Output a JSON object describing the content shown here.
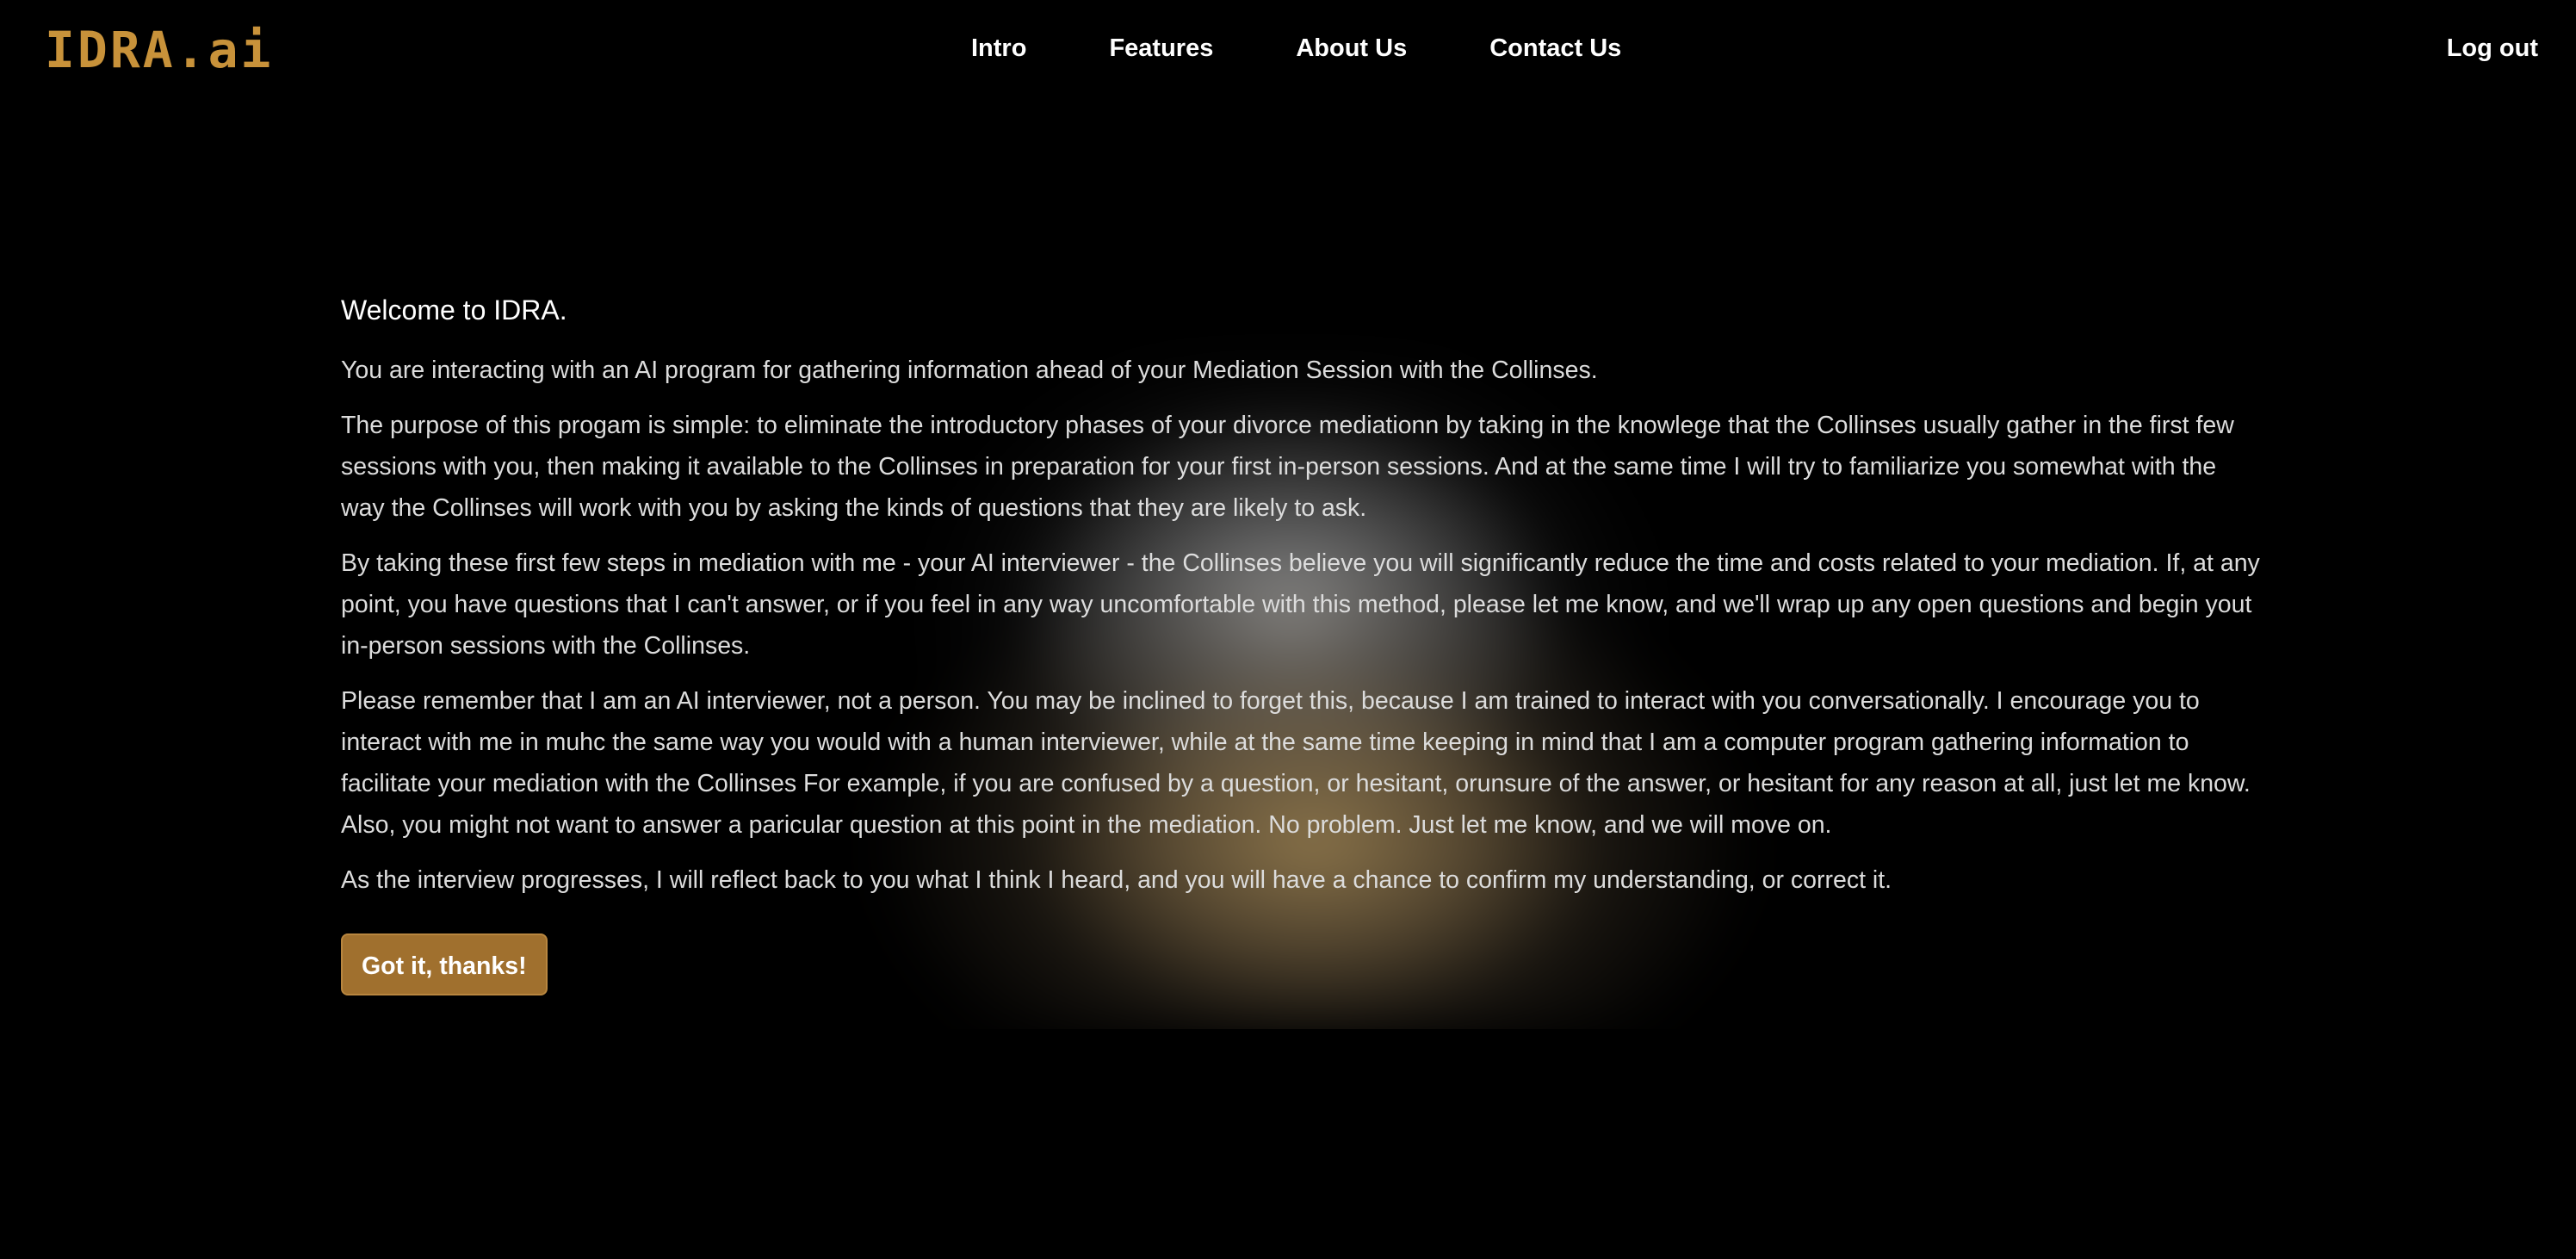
{
  "header": {
    "logo": "IDRA.ai",
    "nav": [
      {
        "label": "Intro"
      },
      {
        "label": "Features"
      },
      {
        "label": "About Us"
      },
      {
        "label": "Contact Us"
      }
    ],
    "logout_label": "Log out"
  },
  "main": {
    "title": "Welcome to IDRA.",
    "paragraphs": [
      "You are interacting with an AI program for gathering information ahead of your Mediation Session with the Collinses.",
      "The purpose of this progam is simple: to eliminate the introductory phases of your divorce mediationn by taking in the knowlege that the Collinses usually gather in the first few sessions with you, then making it available to the Collinses in preparation for your first in-person sessions. And at the same time I will try to familiarize you somewhat with the way the Collinses will work with you by asking the kinds of questions that they are likely to ask.",
      "By taking these first few steps in mediation with me - your AI interviewer - the Collinses believe you will significantly reduce the time and costs related to your mediation. If, at any point, you have questions that I can't answer, or if you feel in any way uncomfortable with this method, please let me know, and we'll wrap up any open questions and begin yout in-person sessions with the Collinses.",
      "Please remember that I am an AI interviewer, not a person. You may be inclined to forget this, because I am trained to interact with you conversationally. I encourage you to interact with me in muhc the same way you would with a human interviewer, while at the same time keeping in mind that I am a computer program gathering information to facilitate your mediation with the Collinses For example, if you are confused by a question, or hesitant, orunsure of the answer, or hesitant for any reason at all, just let me know. Also, you might not want to answer a paricular question at this point in the mediation. No problem. Just let me know, and we will move on.",
      "As the interview progresses, I will reflect back to you what I think I heard, and you will have a chance to confirm my understanding, or correct it."
    ],
    "confirm_label": "Got it, thanks!"
  },
  "colors": {
    "background": "#000000",
    "brand": "#c8923a",
    "button": "#a0702e",
    "text": "#dcdcdc"
  }
}
